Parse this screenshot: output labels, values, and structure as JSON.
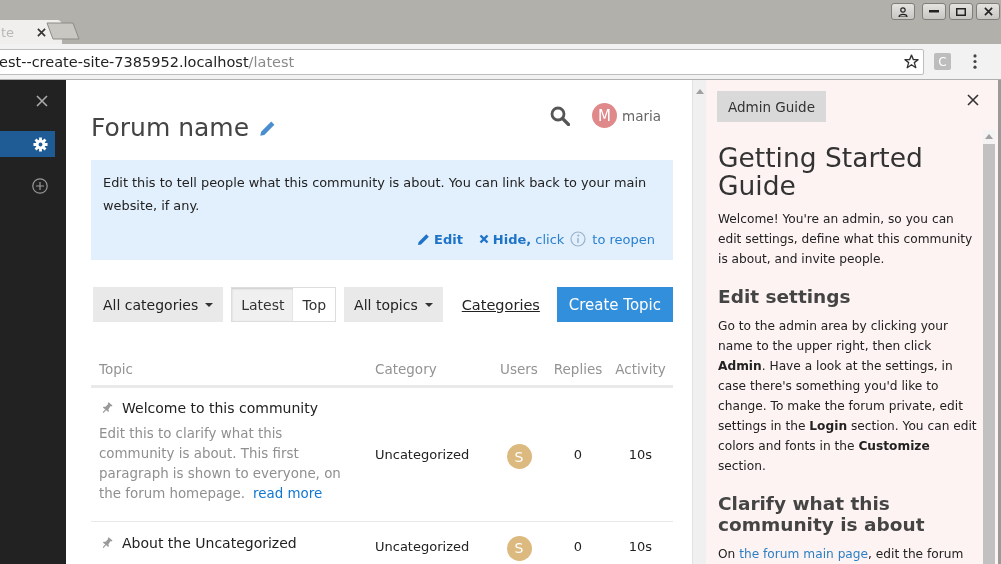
{
  "browser": {
    "tab": {
      "title": "te"
    },
    "address": {
      "host": "est--create-site-7385952.localhost",
      "path": "/latest"
    },
    "extension_badge": "C"
  },
  "sidebar": {
    "items": [
      {
        "kind": "settings",
        "selected": true
      },
      {
        "kind": "add",
        "selected": false
      }
    ]
  },
  "header": {
    "title": "Forum name",
    "user": {
      "initial": "M",
      "name": "maria"
    }
  },
  "banner": {
    "text": "Edit this to tell people what this community is about. You can link back to your main website, if any.",
    "edit": "Edit",
    "hide": "Hide,",
    "click": "click",
    "reopen": "to reopen"
  },
  "nav": {
    "category_filter": "All categories",
    "periods": [
      {
        "label": "Latest",
        "selected": true
      },
      {
        "label": "Top",
        "selected": false
      }
    ],
    "topic_filter": "All topics",
    "categories_link": "Categories",
    "create_button": "Create Topic"
  },
  "table": {
    "columns": [
      "Topic",
      "Category",
      "Users",
      "Replies",
      "Activity"
    ],
    "rows": [
      {
        "pinned": true,
        "title": "Welcome to this community",
        "excerpt": "Edit this to clarify what this community is about. This first paragraph is shown to everyone, on the forum homepage.",
        "read_more": "read more",
        "category": "Uncategorized",
        "user_initial": "S",
        "replies": "0",
        "activity": "10s"
      },
      {
        "pinned": true,
        "title": "About the Uncategorized",
        "category": "Uncategorized",
        "user_initial": "S",
        "replies": "0",
        "activity": "10s"
      }
    ]
  },
  "guide": {
    "tab": "Admin Guide",
    "title": "Getting Started Guide",
    "sections": [
      {
        "kind": "paragraph",
        "text": "Welcome! You're an admin, so you can edit settings, define what this community is about, and invite people."
      },
      {
        "kind": "heading",
        "text": "Edit settings"
      },
      {
        "kind": "paragraph",
        "text": "Go to the admin area by clicking your name to the upper right, then click **Admin**. Have a look at the settings, in case there's something you'd like to change. To make the forum private, edit settings in the **Login** section. You can edit colors and fonts in the **Customize** section."
      },
      {
        "kind": "heading",
        "text": "Clarify what this community is about"
      },
      {
        "kind": "linked",
        "before": "On ",
        "link": "the forum main page",
        "after": ", edit the forum"
      }
    ]
  }
}
